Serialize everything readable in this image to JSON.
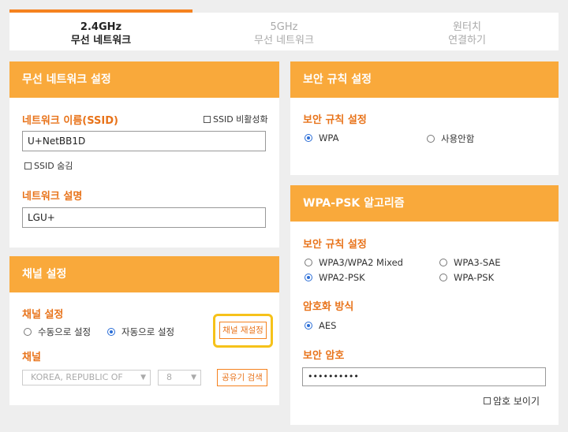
{
  "tabs": [
    {
      "line1": "2.4GHz",
      "line2": "무선 네트워크"
    },
    {
      "line1": "5GHz",
      "line2": "무선 네트워크"
    },
    {
      "line1": "원터치",
      "line2": "연결하기"
    }
  ],
  "wireless": {
    "header": "무선 네트워크 설정",
    "ssid_label": "네트워크 이름(SSID)",
    "ssid_disable_label": "SSID 비활성화",
    "ssid_value": "U+NetBB1D",
    "ssid_hide_label": "SSID 숨김",
    "desc_label": "네트워크 설명",
    "desc_value": "LGU+"
  },
  "channel": {
    "header": "채널 설정",
    "section_label": "채널 설정",
    "manual_label": "수동으로 설정",
    "auto_label": "자동으로 설정",
    "reset_button": "채널 재설정",
    "channel_label": "채널",
    "country_value": "KOREA, REPUBLIC OF",
    "channel_value": "8",
    "share_button": "공유기 검색"
  },
  "security": {
    "header": "보안 규칙 설정",
    "section_label": "보안 규칙 설정",
    "wpa_label": "WPA",
    "none_label": "사용안함"
  },
  "wpa_psk": {
    "header": "WPA-PSK 알고리즘",
    "rule_label": "보안 규칙 설정",
    "opt1": "WPA3/WPA2 Mixed",
    "opt2": "WPA3-SAE",
    "opt3": "WPA2-PSK",
    "opt4": "WPA-PSK",
    "enc_label": "암호화 방식",
    "enc_value": "AES",
    "pw_label": "보안 암호",
    "pw_value": "••••••••••",
    "show_pw_label": "암호 보이기"
  },
  "colors": {
    "accent": "#f5821f",
    "header": "#f9a93b",
    "label": "#e8731a",
    "highlight": "#f6c21a",
    "radio": "#2a6dd6"
  }
}
